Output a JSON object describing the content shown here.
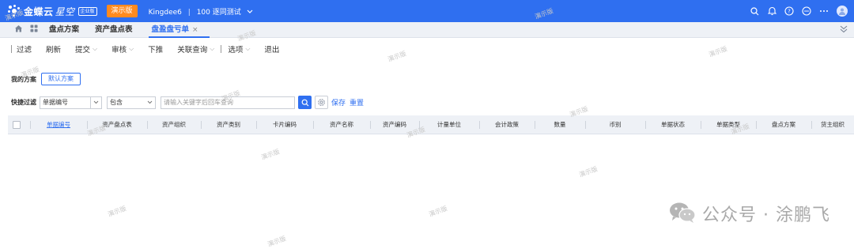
{
  "topbar": {
    "logo_text": "金蝶云",
    "logo_star": "星空",
    "edition": "企业版",
    "demo_label": "演示版",
    "tenant_name": "Kingdee6",
    "tenant_separator": "|",
    "tenant_org": "100 逐同测试",
    "icons": [
      "search-icon",
      "bell-icon",
      "help-icon",
      "apps-icon",
      "more-icon",
      "avatar"
    ]
  },
  "tabs": {
    "items": [
      {
        "label": "盘点方案"
      },
      {
        "label": "资产盘点表"
      },
      {
        "label": "盘盈盘亏单",
        "active": true,
        "close": "×"
      }
    ]
  },
  "toolbar": {
    "filter": "过滤",
    "refresh": "刷新",
    "submit": "提交",
    "audit": "审核",
    "push": "下推",
    "linked_query": "关联查询",
    "options": "选项",
    "exit": "退出"
  },
  "scheme": {
    "label": "我的方案",
    "default_button": "默认方案"
  },
  "quick_filter": {
    "label": "快捷过滤",
    "field_value": "单据编号",
    "operator_value": "包含",
    "input_placeholder": "请输入关键字后回车查询",
    "save": "保存",
    "reset": "重置"
  },
  "grid": {
    "columns": [
      "单据编号",
      "资产盘点表",
      "资产组织",
      "资产类别",
      "卡片编码",
      "资产名称",
      "资产编码",
      "计量单位",
      "会计政策",
      "数量",
      "币别",
      "单据状态",
      "单据类型",
      "盘点方案",
      "货主组织"
    ]
  },
  "watermark_text": "演示版",
  "credit": {
    "text": "公众号 · 涂鹏飞"
  },
  "colors": {
    "primary": "#2f6ff0",
    "demo_badge": "#ff8a1f",
    "header_bg": "#eef1f6"
  }
}
